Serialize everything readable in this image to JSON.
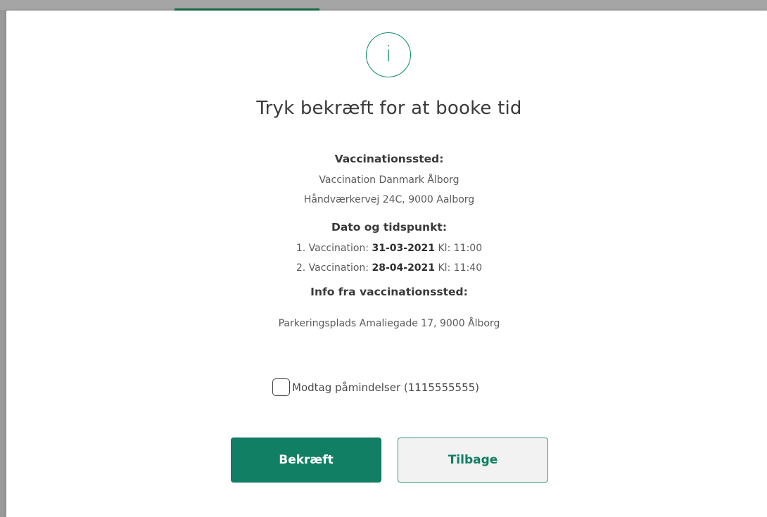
{
  "modal": {
    "icon": "info-icon",
    "icon_glyph": "i",
    "title": "Tryk bekræft for at booke tid"
  },
  "location": {
    "heading": "Vaccinationssted:",
    "name": "Vaccination Danmark Ålborg",
    "address": "Håndværkervej 24C, 9000 Aalborg"
  },
  "schedule": {
    "heading": "Dato og tidspunkt:",
    "items": [
      {
        "label": "1. Vaccination:",
        "date": "31-03-2021",
        "time_label": "Kl:",
        "time": "11:00"
      },
      {
        "label": "2. Vaccination:",
        "date": "28-04-2021",
        "time_label": "Kl:",
        "time": "11:40"
      }
    ]
  },
  "info": {
    "heading": "Info fra vaccinationssted:",
    "text": "Parkeringsplads Amaliegade 17, 9000 Ålborg"
  },
  "reminder": {
    "label": "Modtag påmindelser (1115555555)",
    "checked": false
  },
  "buttons": {
    "confirm_label": "Bekræft",
    "back_label": "Tilbage"
  },
  "colors": {
    "accent": "#117f63",
    "icon": "#0d8a6a",
    "back_button_bg": "#f2f2f2"
  }
}
